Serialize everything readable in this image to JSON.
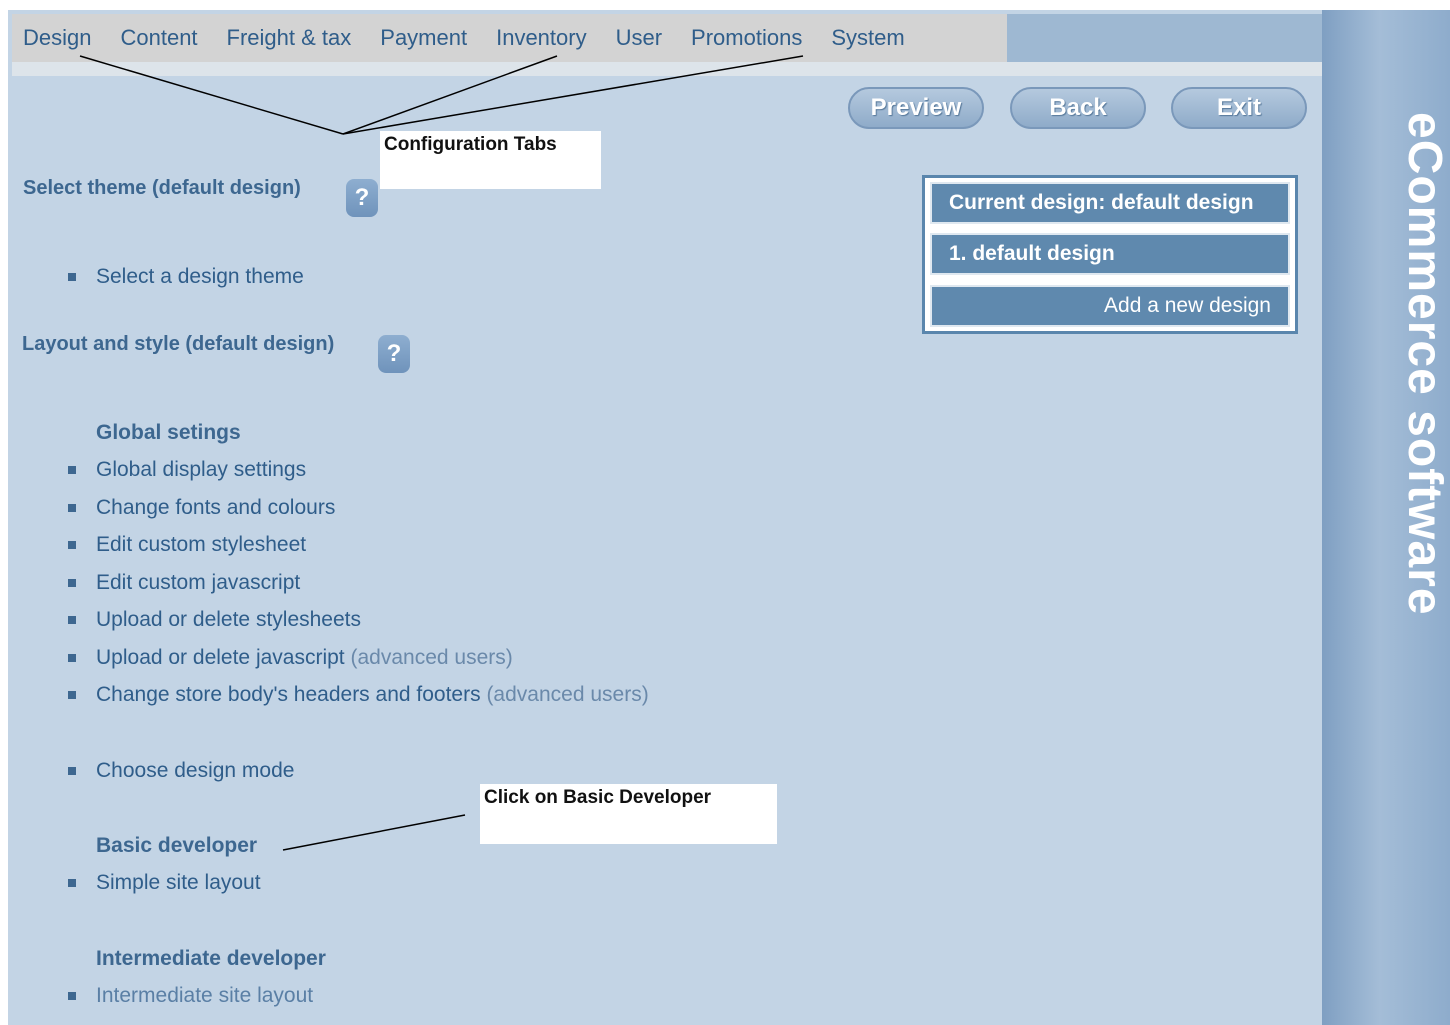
{
  "tabs": [
    "Design",
    "Content",
    "Freight & tax",
    "Payment",
    "Inventory",
    "User",
    "Promotions",
    "System"
  ],
  "buttons": {
    "preview": "Preview",
    "back": "Back",
    "exit": "Exit"
  },
  "brand": "eCommerce software",
  "annotations": {
    "config_tabs": "Configuration Tabs",
    "basic_dev": "Click on Basic Developer"
  },
  "sections": {
    "select_theme": {
      "title": "Select theme (default design)",
      "help": "?"
    },
    "layout_style": {
      "title": "Layout and style (default design)",
      "help": "?"
    }
  },
  "items": {
    "select_theme": "Select a design theme",
    "global_heading": "Global setings",
    "global_display": "Global display settings",
    "fonts_colours": "Change fonts and colours",
    "custom_stylesheet": "Edit custom stylesheet",
    "custom_js": "Edit custom javascript",
    "upload_stylesheets": "Upload or delete stylesheets",
    "upload_js": "Upload or delete javascript",
    "headers_footers": "Change store body's headers and footers",
    "advanced_users": "(advanced users)",
    "design_mode": "Choose design mode",
    "basic_dev_heading": "Basic developer",
    "simple_layout": "Simple site layout",
    "intermediate_heading": "Intermediate developer",
    "intermediate_layout": "Intermediate site layout"
  },
  "design_panel": {
    "current": "Current design: default design",
    "entry": "1. default design",
    "add": "Add a new design"
  }
}
